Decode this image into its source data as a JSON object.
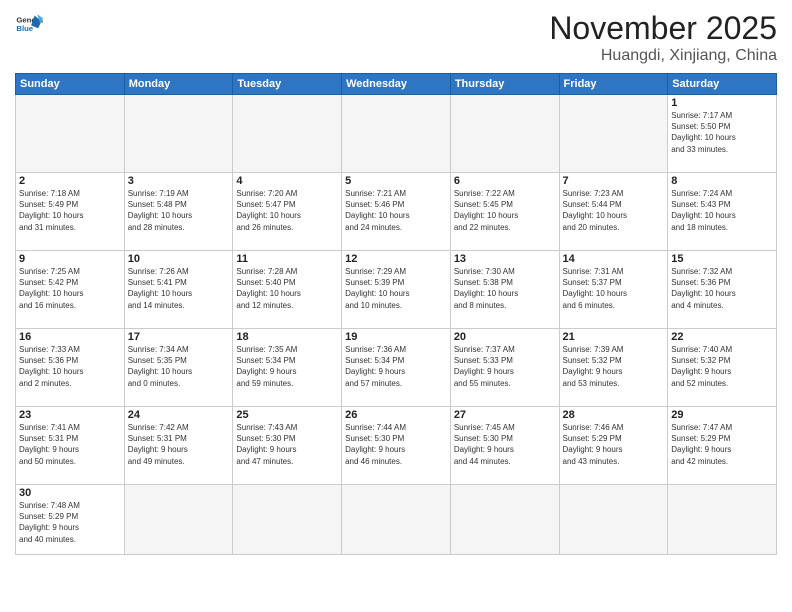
{
  "header": {
    "logo_general": "General",
    "logo_blue": "Blue",
    "month": "November 2025",
    "location": "Huangdi, Xinjiang, China"
  },
  "weekdays": [
    "Sunday",
    "Monday",
    "Tuesday",
    "Wednesday",
    "Thursday",
    "Friday",
    "Saturday"
  ],
  "weeks": [
    [
      {
        "day": "",
        "info": ""
      },
      {
        "day": "",
        "info": ""
      },
      {
        "day": "",
        "info": ""
      },
      {
        "day": "",
        "info": ""
      },
      {
        "day": "",
        "info": ""
      },
      {
        "day": "",
        "info": ""
      },
      {
        "day": "1",
        "info": "Sunrise: 7:17 AM\nSunset: 5:50 PM\nDaylight: 10 hours\nand 33 minutes."
      }
    ],
    [
      {
        "day": "2",
        "info": "Sunrise: 7:18 AM\nSunset: 5:49 PM\nDaylight: 10 hours\nand 31 minutes."
      },
      {
        "day": "3",
        "info": "Sunrise: 7:19 AM\nSunset: 5:48 PM\nDaylight: 10 hours\nand 28 minutes."
      },
      {
        "day": "4",
        "info": "Sunrise: 7:20 AM\nSunset: 5:47 PM\nDaylight: 10 hours\nand 26 minutes."
      },
      {
        "day": "5",
        "info": "Sunrise: 7:21 AM\nSunset: 5:46 PM\nDaylight: 10 hours\nand 24 minutes."
      },
      {
        "day": "6",
        "info": "Sunrise: 7:22 AM\nSunset: 5:45 PM\nDaylight: 10 hours\nand 22 minutes."
      },
      {
        "day": "7",
        "info": "Sunrise: 7:23 AM\nSunset: 5:44 PM\nDaylight: 10 hours\nand 20 minutes."
      },
      {
        "day": "8",
        "info": "Sunrise: 7:24 AM\nSunset: 5:43 PM\nDaylight: 10 hours\nand 18 minutes."
      }
    ],
    [
      {
        "day": "9",
        "info": "Sunrise: 7:25 AM\nSunset: 5:42 PM\nDaylight: 10 hours\nand 16 minutes."
      },
      {
        "day": "10",
        "info": "Sunrise: 7:26 AM\nSunset: 5:41 PM\nDaylight: 10 hours\nand 14 minutes."
      },
      {
        "day": "11",
        "info": "Sunrise: 7:28 AM\nSunset: 5:40 PM\nDaylight: 10 hours\nand 12 minutes."
      },
      {
        "day": "12",
        "info": "Sunrise: 7:29 AM\nSunset: 5:39 PM\nDaylight: 10 hours\nand 10 minutes."
      },
      {
        "day": "13",
        "info": "Sunrise: 7:30 AM\nSunset: 5:38 PM\nDaylight: 10 hours\nand 8 minutes."
      },
      {
        "day": "14",
        "info": "Sunrise: 7:31 AM\nSunset: 5:37 PM\nDaylight: 10 hours\nand 6 minutes."
      },
      {
        "day": "15",
        "info": "Sunrise: 7:32 AM\nSunset: 5:36 PM\nDaylight: 10 hours\nand 4 minutes."
      }
    ],
    [
      {
        "day": "16",
        "info": "Sunrise: 7:33 AM\nSunset: 5:36 PM\nDaylight: 10 hours\nand 2 minutes."
      },
      {
        "day": "17",
        "info": "Sunrise: 7:34 AM\nSunset: 5:35 PM\nDaylight: 10 hours\nand 0 minutes."
      },
      {
        "day": "18",
        "info": "Sunrise: 7:35 AM\nSunset: 5:34 PM\nDaylight: 9 hours\nand 59 minutes."
      },
      {
        "day": "19",
        "info": "Sunrise: 7:36 AM\nSunset: 5:34 PM\nDaylight: 9 hours\nand 57 minutes."
      },
      {
        "day": "20",
        "info": "Sunrise: 7:37 AM\nSunset: 5:33 PM\nDaylight: 9 hours\nand 55 minutes."
      },
      {
        "day": "21",
        "info": "Sunrise: 7:39 AM\nSunset: 5:32 PM\nDaylight: 9 hours\nand 53 minutes."
      },
      {
        "day": "22",
        "info": "Sunrise: 7:40 AM\nSunset: 5:32 PM\nDaylight: 9 hours\nand 52 minutes."
      }
    ],
    [
      {
        "day": "23",
        "info": "Sunrise: 7:41 AM\nSunset: 5:31 PM\nDaylight: 9 hours\nand 50 minutes."
      },
      {
        "day": "24",
        "info": "Sunrise: 7:42 AM\nSunset: 5:31 PM\nDaylight: 9 hours\nand 49 minutes."
      },
      {
        "day": "25",
        "info": "Sunrise: 7:43 AM\nSunset: 5:30 PM\nDaylight: 9 hours\nand 47 minutes."
      },
      {
        "day": "26",
        "info": "Sunrise: 7:44 AM\nSunset: 5:30 PM\nDaylight: 9 hours\nand 46 minutes."
      },
      {
        "day": "27",
        "info": "Sunrise: 7:45 AM\nSunset: 5:30 PM\nDaylight: 9 hours\nand 44 minutes."
      },
      {
        "day": "28",
        "info": "Sunrise: 7:46 AM\nSunset: 5:29 PM\nDaylight: 9 hours\nand 43 minutes."
      },
      {
        "day": "29",
        "info": "Sunrise: 7:47 AM\nSunset: 5:29 PM\nDaylight: 9 hours\nand 42 minutes."
      }
    ],
    [
      {
        "day": "30",
        "info": "Sunrise: 7:48 AM\nSunset: 5:29 PM\nDaylight: 9 hours\nand 40 minutes."
      },
      {
        "day": "",
        "info": ""
      },
      {
        "day": "",
        "info": ""
      },
      {
        "day": "",
        "info": ""
      },
      {
        "day": "",
        "info": ""
      },
      {
        "day": "",
        "info": ""
      },
      {
        "day": "",
        "info": ""
      }
    ]
  ]
}
